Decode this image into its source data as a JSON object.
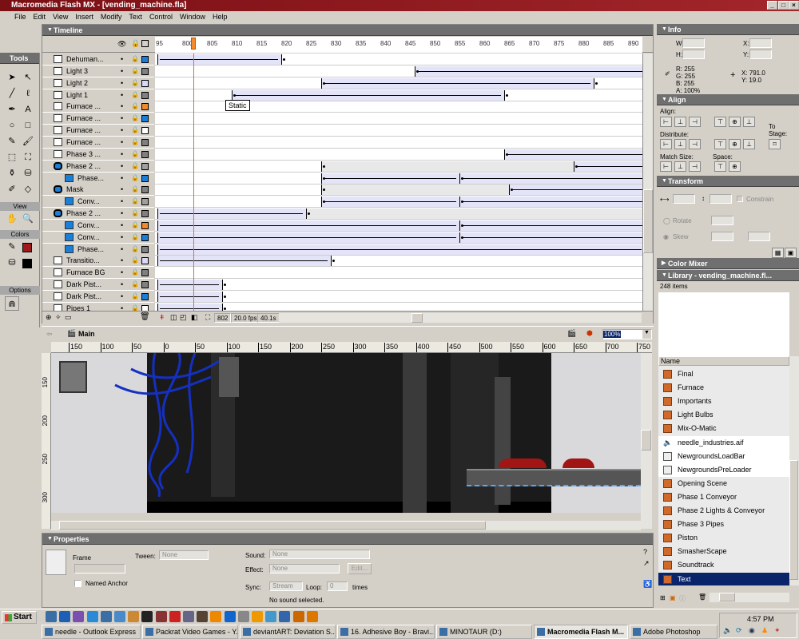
{
  "window": {
    "title": "Macromedia Flash MX - [vending_machine.fla]"
  },
  "menu": [
    "File",
    "Edit",
    "View",
    "Insert",
    "Modify",
    "Text",
    "Control",
    "Window",
    "Help"
  ],
  "tools": {
    "title": "Tools",
    "view_label": "View",
    "colors_label": "Colors",
    "options_label": "Options",
    "stroke_color": "#a01818",
    "fill_color": "#000000"
  },
  "timeline": {
    "title": "Timeline",
    "frame_numbers": [
      "95",
      "800",
      "805",
      "810",
      "815",
      "820",
      "825",
      "830",
      "835",
      "840",
      "845",
      "850",
      "855",
      "860",
      "865",
      "870",
      "875",
      "880",
      "885",
      "890"
    ],
    "current_frame": "802",
    "fps": "20.0 fps",
    "elapsed": "40.1s",
    "tooltip": "Static",
    "layers": [
      {
        "name": "Dehuman...",
        "type": "layer",
        "color": "#1a7fd8",
        "spans": [
          [
            795,
            819,
            "t"
          ]
        ],
        "keys": [
          820
        ]
      },
      {
        "name": "Light 3",
        "type": "layer",
        "color": "#808080",
        "spans": [
          [
            847,
            893,
            "t"
          ]
        ],
        "keys": [
          847
        ]
      },
      {
        "name": "Light 2",
        "type": "layer",
        "color": "#d8d8f8",
        "spans": [
          [
            828,
            882,
            "t"
          ]
        ],
        "keys": [
          828,
          883
        ]
      },
      {
        "name": "Light 1",
        "type": "layer",
        "color": "#808080",
        "spans": [
          [
            810,
            864,
            "t"
          ]
        ],
        "keys": [
          810,
          865
        ]
      },
      {
        "name": "Furnace ...",
        "type": "layer",
        "color": "#f08a30",
        "spans": [],
        "keys": []
      },
      {
        "name": "Furnace ...",
        "type": "layer",
        "color": "#1a7fd8",
        "spans": [],
        "keys": []
      },
      {
        "name": "Furnace ...",
        "type": "layer",
        "color": "#ffffff",
        "spans": [],
        "keys": []
      },
      {
        "name": "Furnace ...",
        "type": "layer",
        "color": "#808080",
        "spans": [],
        "keys": []
      },
      {
        "name": "Phase 3 ...",
        "type": "layer",
        "color": "#808080",
        "spans": [
          [
            865,
            893,
            "t"
          ]
        ],
        "keys": [
          865
        ]
      },
      {
        "name": "Phase 2 ...",
        "type": "mask",
        "color": "#a0a0a0",
        "spans": [
          [
            828,
            878,
            "g"
          ],
          [
            879,
            893,
            "t"
          ]
        ],
        "keys": [
          828,
          879
        ]
      },
      {
        "name": "Phase...",
        "type": "masked",
        "color": "#1a7fd8",
        "spans": [
          [
            828,
            855,
            "t"
          ],
          [
            856,
            893,
            "t"
          ]
        ],
        "keys": [
          828,
          856
        ]
      },
      {
        "name": "Mask",
        "type": "mask",
        "color": "#808080",
        "spans": [
          [
            828,
            865,
            "g"
          ],
          [
            866,
            893,
            "t"
          ]
        ],
        "keys": [
          828,
          866
        ]
      },
      {
        "name": "Conv...",
        "type": "masked",
        "color": "#a0a0a0",
        "spans": [
          [
            828,
            855,
            "t"
          ],
          [
            856,
            893,
            "t"
          ]
        ],
        "keys": [
          828,
          856
        ]
      },
      {
        "name": "Phase 2 ...",
        "type": "mask",
        "color": "#808080",
        "spans": [
          [
            795,
            824,
            "t"
          ],
          [
            825,
            893,
            "g"
          ]
        ],
        "keys": [
          825
        ]
      },
      {
        "name": "Conv...",
        "type": "masked",
        "color": "#f08a30",
        "spans": [
          [
            795,
            855,
            "t"
          ],
          [
            856,
            893,
            "t"
          ]
        ],
        "keys": [
          856
        ]
      },
      {
        "name": "Conv...",
        "type": "masked",
        "color": "#1a7fd8",
        "spans": [
          [
            795,
            855,
            "t"
          ],
          [
            856,
            893,
            "t"
          ]
        ],
        "keys": [
          856
        ]
      },
      {
        "name": "Phase...",
        "type": "masked",
        "color": "#808080",
        "spans": [
          [
            795,
            893,
            "t"
          ]
        ],
        "keys": []
      },
      {
        "name": "Transitio...",
        "type": "layer",
        "color": "#d8d8f8",
        "spans": [
          [
            795,
            829,
            "t"
          ]
        ],
        "keys": [
          830
        ]
      },
      {
        "name": "Furnace BG",
        "type": "layer",
        "color": "#808080",
        "spans": [],
        "keys": []
      },
      {
        "name": "Dark Pist...",
        "type": "layer",
        "color": "#808080",
        "spans": [
          [
            795,
            807,
            "t"
          ]
        ],
        "keys": [
          808
        ]
      },
      {
        "name": "Dark Pist...",
        "type": "layer",
        "color": "#1a7fd8",
        "spans": [
          [
            795,
            807,
            "t"
          ]
        ],
        "keys": [
          808
        ]
      },
      {
        "name": "Pipes 1",
        "type": "layer",
        "color": "#ffffff",
        "spans": [
          [
            795,
            807,
            "t"
          ]
        ],
        "keys": [
          808
        ]
      }
    ]
  },
  "stage": {
    "scene": "Main",
    "zoom": "100%",
    "ruler": [
      "150",
      "100",
      "50",
      "0",
      "50",
      "100",
      "150",
      "200",
      "250",
      "300",
      "350",
      "400",
      "450",
      "500",
      "550",
      "600",
      "650",
      "700",
      "750"
    ],
    "vruler": [
      "150",
      "200",
      "250",
      "300"
    ]
  },
  "properties": {
    "title": "Properties",
    "frame_label": "Frame",
    "tween_label": "Tween:",
    "tween_value": "None",
    "named_anchor": "Named Anchor",
    "sound_label": "Sound:",
    "sound_value": "None",
    "effect_label": "Effect:",
    "effect_value": "None",
    "edit_button": "Edit...",
    "sync_label": "Sync:",
    "sync_value": "Stream",
    "loop_label": "Loop:",
    "loop_value": "0",
    "times_label": "times",
    "status": "No sound selected."
  },
  "info": {
    "title": "Info",
    "w_label": "W:",
    "h_label": "H:",
    "x_label": "X:",
    "y_label": "Y:",
    "r": "R: 255",
    "g": "G: 255",
    "b": "B: 255",
    "a": "A: 100%",
    "cursor_x": "X: 791.0",
    "cursor_y": "Y: 19.0"
  },
  "align": {
    "title": "Align",
    "align_label": "Align:",
    "distribute_label": "Distribute:",
    "match_label": "Match Size:",
    "space_label": "Space:",
    "to_stage": "To Stage:"
  },
  "transform": {
    "title": "Transform",
    "constrain": "Constrain",
    "rotate": "Rotate",
    "skew": "Skew"
  },
  "color_mixer": {
    "title": "Color Mixer"
  },
  "library": {
    "title": "Library - vending_machine.fl...",
    "count": "248 items",
    "column": "Name",
    "items": [
      {
        "name": "Final",
        "icon": "movieclip"
      },
      {
        "name": "Furnace",
        "icon": "movieclip"
      },
      {
        "name": "Importants",
        "icon": "movieclip"
      },
      {
        "name": "Light Bulbs",
        "icon": "movieclip"
      },
      {
        "name": "Mix-O-Matic",
        "icon": "movieclip"
      },
      {
        "name": "needle_industries.aif",
        "icon": "sound"
      },
      {
        "name": "NewgroundsLoadBar",
        "icon": "graphic"
      },
      {
        "name": "NewgroundsPreLoader",
        "icon": "graphic"
      },
      {
        "name": "Opening Scene",
        "icon": "movieclip"
      },
      {
        "name": "Phase 1 Conveyor",
        "icon": "movieclip"
      },
      {
        "name": "Phase 2 Lights & Conveyor",
        "icon": "movieclip"
      },
      {
        "name": "Phase 3 Pipes",
        "icon": "movieclip"
      },
      {
        "name": "Piston",
        "icon": "movieclip"
      },
      {
        "name": "SmasherScape",
        "icon": "movieclip"
      },
      {
        "name": "Soundtrack",
        "icon": "movieclip"
      },
      {
        "name": "Text",
        "icon": "movieclip",
        "selected": true
      }
    ]
  },
  "taskbar": {
    "start": "Start",
    "clock": "4:57 PM",
    "tasks": [
      "needle - Outlook Express",
      "Packrat Video Games - Y...",
      "deviantART: Deviation S...",
      "16. Adhesive Boy - Bravi...",
      "MINOTAUR (D:)",
      "Macromedia Flash M...",
      "Adobe Photoshop"
    ],
    "active_task": 5
  }
}
